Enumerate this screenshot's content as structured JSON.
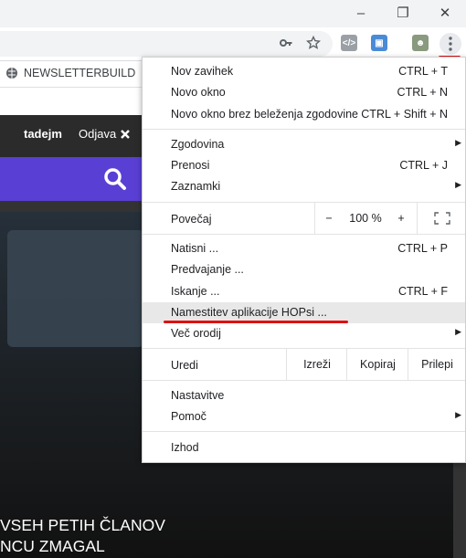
{
  "window": {
    "minimize_glyph": "–",
    "restore_glyph": "❐",
    "close_glyph": "✕"
  },
  "toolbar": {
    "icons": [
      "key-icon",
      "star-icon",
      "code-extension-icon",
      "blue-extension-icon",
      "avatar-extension-icon",
      "menu-dots-icon"
    ]
  },
  "bookmarks": {
    "item": "NEWSLETTERBUILD"
  },
  "site": {
    "user": "tadejm",
    "logout": "Odjava",
    "headline_line1": "VSEH PETIH ČLANOV",
    "headline_line2": "NCU ZMAGAL"
  },
  "menu": {
    "new_tab": {
      "label": "Nov zavihek",
      "shortcut": "CTRL + T"
    },
    "new_window": {
      "label": "Novo okno",
      "shortcut": "CTRL + N"
    },
    "incognito": {
      "label": "Novo okno brez beleženja zgodovine",
      "shortcut": "CTRL + Shift + N"
    },
    "history": {
      "label": "Zgodovina"
    },
    "downloads": {
      "label": "Prenosi",
      "shortcut": "CTRL + J"
    },
    "bookmarks": {
      "label": "Zaznamki"
    },
    "zoom": {
      "label": "Povečaj",
      "minus": "−",
      "value": "100 %",
      "plus": "+"
    },
    "print": {
      "label": "Natisni ...",
      "shortcut": "CTRL + P"
    },
    "cast": {
      "label": "Predvajanje ..."
    },
    "find": {
      "label": "Iskanje ...",
      "shortcut": "CTRL + F"
    },
    "install": {
      "label": "Namestitev aplikacije HOPsi ..."
    },
    "more_tools": {
      "label": "Več orodij"
    },
    "edit": {
      "label": "Uredi",
      "cut": "Izreži",
      "copy": "Kopiraj",
      "paste": "Prilepi"
    },
    "settings": {
      "label": "Nastavitve"
    },
    "help": {
      "label": "Pomoč"
    },
    "exit": {
      "label": "Izhod"
    }
  },
  "colors": {
    "highlight": "#e01010",
    "accent_bar": "#5a3fd4"
  }
}
